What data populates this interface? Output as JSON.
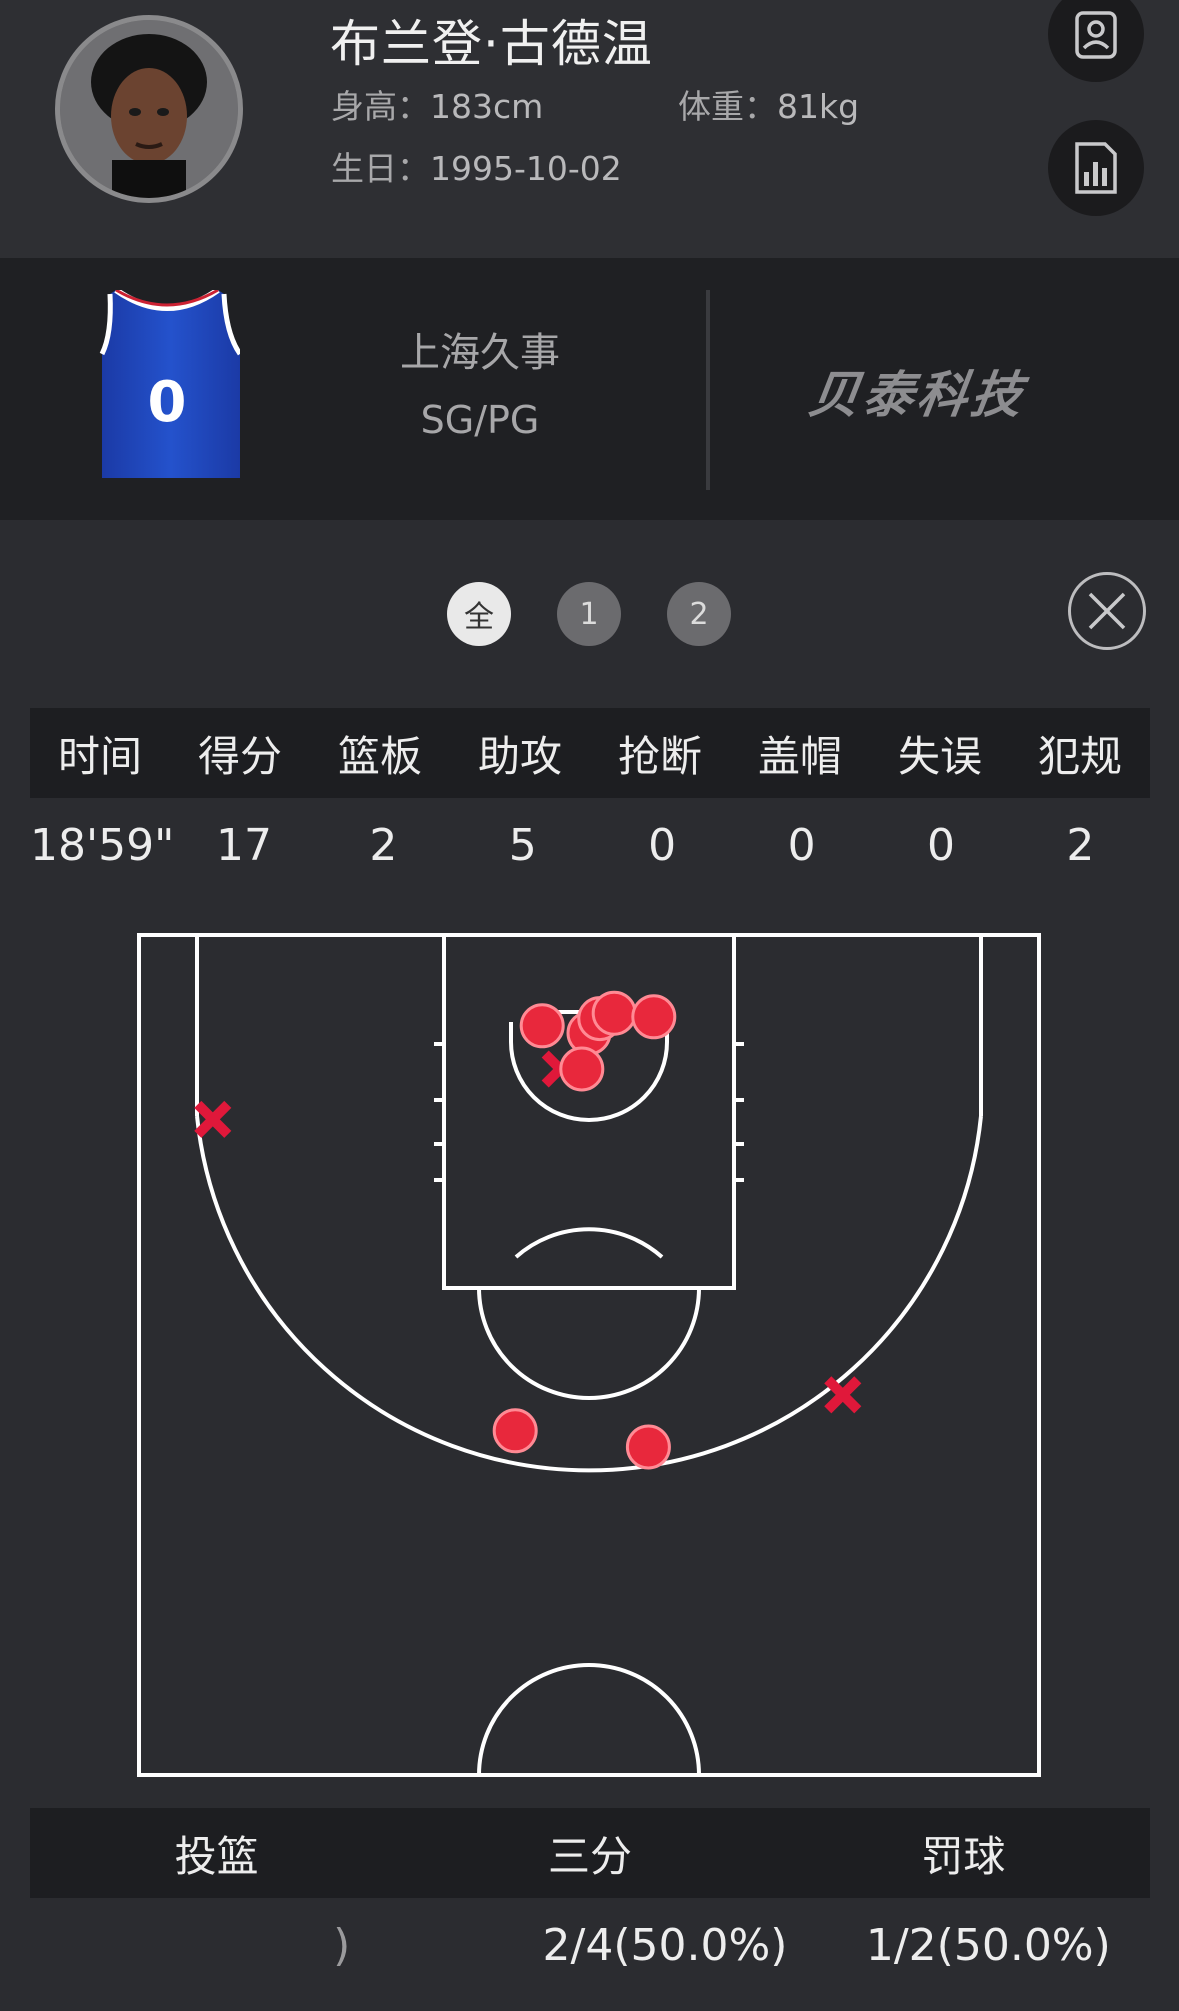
{
  "player": {
    "name": "布兰登·古德温",
    "height_label": "身高：",
    "height": "183cm",
    "weight_label": "体重：",
    "weight": "81kg",
    "birthday_label": "生日：",
    "birthday": "1995-10-02",
    "jersey_number": "0",
    "team": "上海久事",
    "position": "SG/PG"
  },
  "brand": "贝泰科技",
  "icons": {
    "profile_button": "person-card-icon",
    "stats_button": "bar-chart-doc-icon",
    "close_button": "close-icon"
  },
  "periods": [
    {
      "label": "全",
      "active": true
    },
    {
      "label": "1",
      "active": false
    },
    {
      "label": "2",
      "active": false
    }
  ],
  "stats": {
    "headers": [
      "时间",
      "得分",
      "篮板",
      "助攻",
      "抢断",
      "盖帽",
      "失误",
      "犯规"
    ],
    "values": [
      "18'59\"",
      "17",
      "2",
      "5",
      "0",
      "0",
      "0",
      "2"
    ]
  },
  "shot_chart": {
    "made_color": "#e8283c",
    "missed_color": "#e0183a",
    "made_shots": [
      {
        "x": 0,
        "y": 0.5
      },
      {
        "x": 0.6,
        "y": 1.3
      },
      {
        "x": 1.4,
        "y": 1.6
      },
      {
        "x": 3.6,
        "y": 1.4
      },
      {
        "x": -2.6,
        "y": 0.9
      },
      {
        "x": -0.4,
        "y": -1.5
      },
      {
        "x": -4.1,
        "y": -21.6
      },
      {
        "x": 3.3,
        "y": -22.5
      }
    ],
    "missed_shots": [
      {
        "x": -1.6,
        "y": -1.5
      },
      {
        "x": -20.9,
        "y": -4.3
      },
      {
        "x": 14.1,
        "y": -19.6
      }
    ]
  },
  "shooting": {
    "headers": [
      "投篮",
      "三分",
      "罚球"
    ],
    "values": [
      ")",
      "2/4(50.0%)",
      "1/2(50.0%)"
    ]
  },
  "colors": {
    "background": "#2b2c30",
    "header_band": "#1d1e21",
    "accent_red": "#e8283c",
    "jersey_blue": "#1d43b5"
  }
}
